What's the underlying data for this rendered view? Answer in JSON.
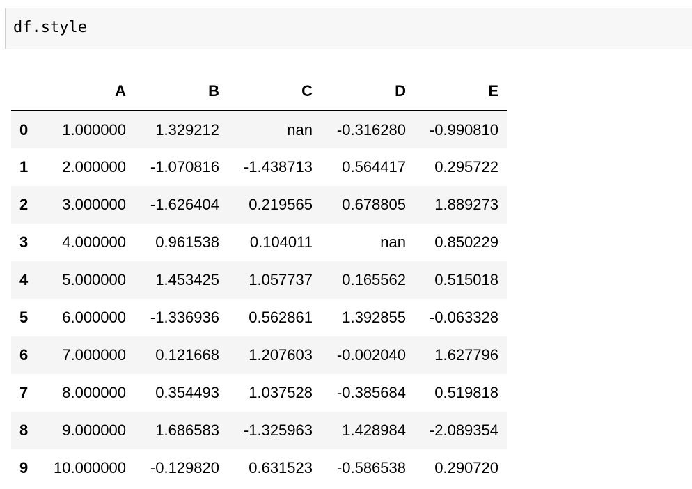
{
  "code_cell": {
    "source": "df.style"
  },
  "dataframe": {
    "index_header": "",
    "columns": [
      "A",
      "B",
      "C",
      "D",
      "E"
    ],
    "rows": [
      {
        "index": "0",
        "cells": [
          "1.000000",
          "1.329212",
          "nan",
          "-0.316280",
          "-0.990810"
        ]
      },
      {
        "index": "1",
        "cells": [
          "2.000000",
          "-1.070816",
          "-1.438713",
          "0.564417",
          "0.295722"
        ]
      },
      {
        "index": "2",
        "cells": [
          "3.000000",
          "-1.626404",
          "0.219565",
          "0.678805",
          "1.889273"
        ]
      },
      {
        "index": "3",
        "cells": [
          "4.000000",
          "0.961538",
          "0.104011",
          "nan",
          "0.850229"
        ]
      },
      {
        "index": "4",
        "cells": [
          "5.000000",
          "1.453425",
          "1.057737",
          "0.165562",
          "0.515018"
        ]
      },
      {
        "index": "5",
        "cells": [
          "6.000000",
          "-1.336936",
          "0.562861",
          "1.392855",
          "-0.063328"
        ]
      },
      {
        "index": "6",
        "cells": [
          "7.000000",
          "0.121668",
          "1.207603",
          "-0.002040",
          "1.627796"
        ]
      },
      {
        "index": "7",
        "cells": [
          "8.000000",
          "0.354493",
          "1.037528",
          "-0.385684",
          "0.519818"
        ]
      },
      {
        "index": "8",
        "cells": [
          "9.000000",
          "1.686583",
          "-1.325963",
          "1.428984",
          "-2.089354"
        ]
      },
      {
        "index": "9",
        "cells": [
          "10.000000",
          "-0.129820",
          "0.631523",
          "-0.586538",
          "0.290720"
        ]
      }
    ]
  }
}
